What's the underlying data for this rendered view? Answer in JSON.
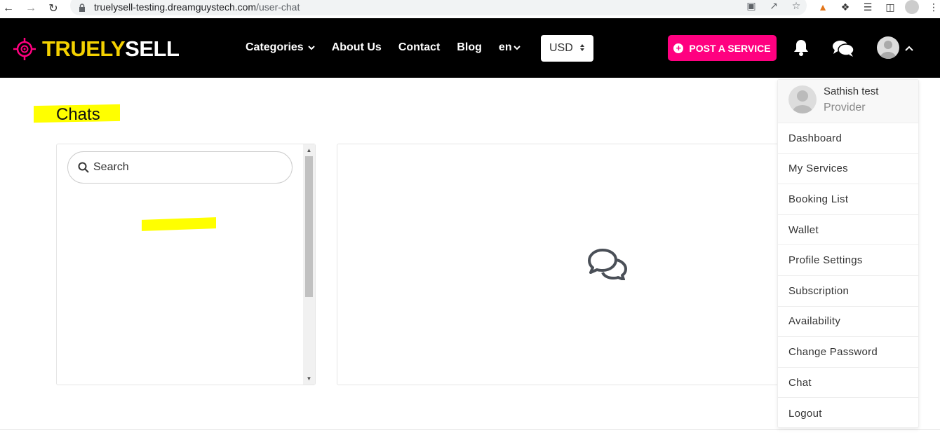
{
  "browser": {
    "url_host": "truelysell-testing.dreamguystech.com",
    "url_path": "/user-chat"
  },
  "header": {
    "logo_part1": "TRUELY",
    "logo_part2": "SELL",
    "nav": [
      {
        "label": "Categories"
      },
      {
        "label": "About Us"
      },
      {
        "label": "Contact"
      },
      {
        "label": "Blog"
      },
      {
        "label": "en"
      }
    ],
    "currency": "USD",
    "post_button": "POST A SERVICE"
  },
  "page": {
    "title": "Chats",
    "search_placeholder": "Search"
  },
  "dropdown": {
    "name": "Sathish test",
    "role": "Provider",
    "items": [
      {
        "label": "Dashboard"
      },
      {
        "label": "My Services"
      },
      {
        "label": "Booking List"
      },
      {
        "label": "Wallet"
      },
      {
        "label": "Profile Settings"
      },
      {
        "label": "Subscription"
      },
      {
        "label": "Availability"
      },
      {
        "label": "Change Password"
      },
      {
        "label": "Chat"
      },
      {
        "label": "Logout"
      }
    ]
  },
  "colors": {
    "brand_yellow": "#f4d100",
    "brand_pink": "#ff0080",
    "header_bg": "#000000",
    "highlight": "#ffff00"
  }
}
